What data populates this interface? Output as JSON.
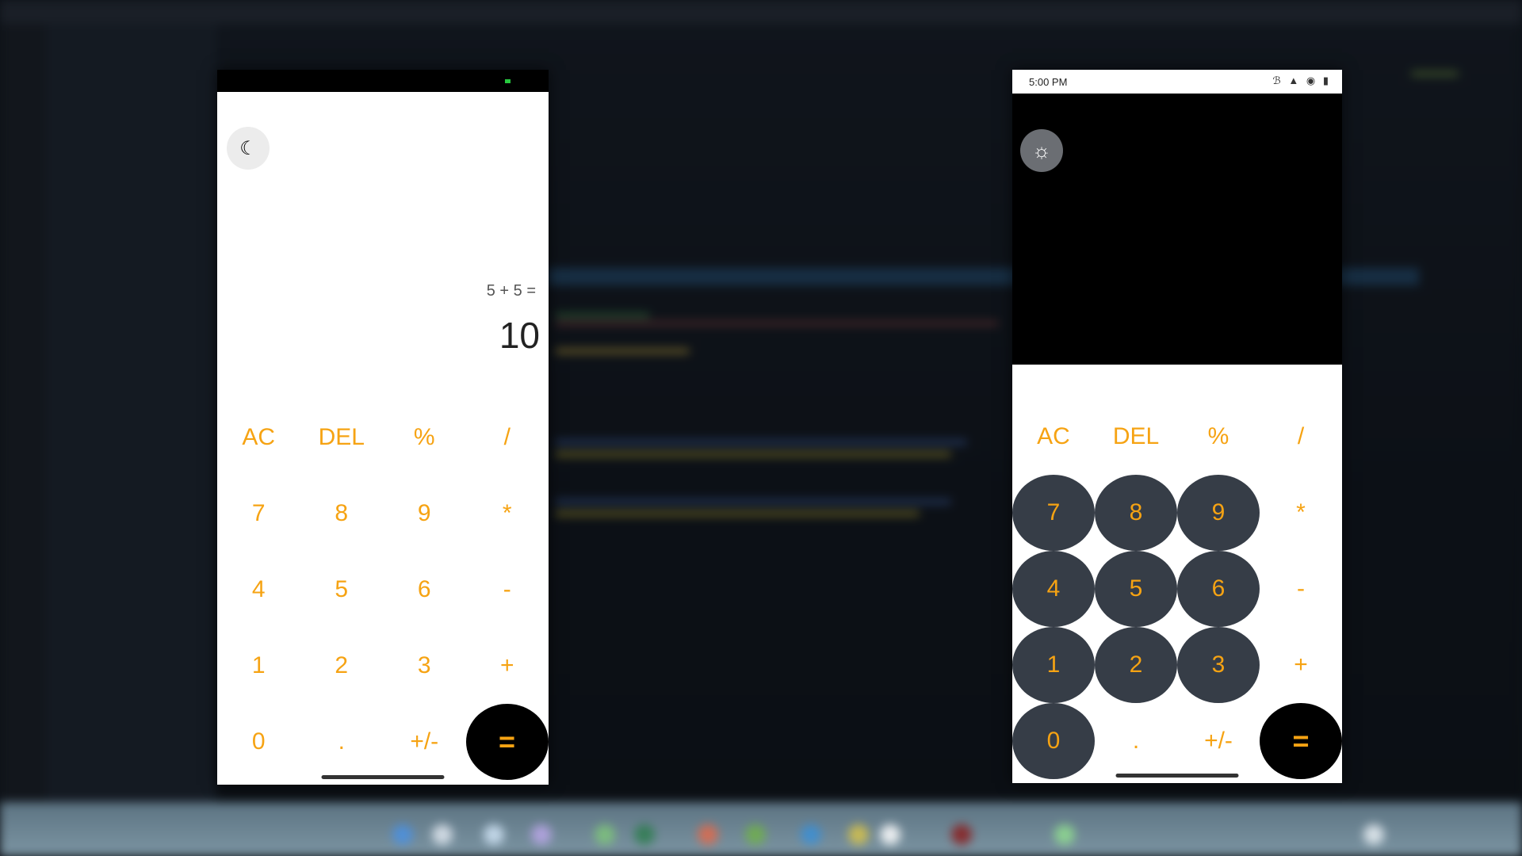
{
  "left_phone": {
    "theme_toggle_icon": "moon-icon",
    "display": {
      "expression": "5 + 5 =",
      "result": "10"
    },
    "keys": [
      {
        "label": "AC",
        "kind": "plain"
      },
      {
        "label": "DEL",
        "kind": "plain"
      },
      {
        "label": "%",
        "kind": "plain"
      },
      {
        "label": "/",
        "kind": "plain"
      },
      {
        "label": "7",
        "kind": "plain"
      },
      {
        "label": "8",
        "kind": "plain"
      },
      {
        "label": "9",
        "kind": "plain"
      },
      {
        "label": "*",
        "kind": "plain"
      },
      {
        "label": "4",
        "kind": "plain"
      },
      {
        "label": "5",
        "kind": "plain"
      },
      {
        "label": "6",
        "kind": "plain"
      },
      {
        "label": "-",
        "kind": "plain"
      },
      {
        "label": "1",
        "kind": "plain"
      },
      {
        "label": "2",
        "kind": "plain"
      },
      {
        "label": "3",
        "kind": "plain"
      },
      {
        "label": "+",
        "kind": "plain"
      },
      {
        "label": "0",
        "kind": "plain"
      },
      {
        "label": ".",
        "kind": "plain"
      },
      {
        "label": "+/-",
        "kind": "plain"
      },
      {
        "label": "=",
        "kind": "equals"
      }
    ]
  },
  "right_phone": {
    "status_time": "5:00 PM",
    "theme_toggle_icon": "sun-icon",
    "keys": [
      {
        "label": "AC",
        "kind": "plain"
      },
      {
        "label": "DEL",
        "kind": "plain"
      },
      {
        "label": "%",
        "kind": "plain"
      },
      {
        "label": "/",
        "kind": "plain"
      },
      {
        "label": "7",
        "kind": "dark"
      },
      {
        "label": "8",
        "kind": "dark"
      },
      {
        "label": "9",
        "kind": "dark"
      },
      {
        "label": "*",
        "kind": "plain"
      },
      {
        "label": "4",
        "kind": "dark"
      },
      {
        "label": "5",
        "kind": "dark"
      },
      {
        "label": "6",
        "kind": "dark"
      },
      {
        "label": "-",
        "kind": "plain"
      },
      {
        "label": "1",
        "kind": "dark"
      },
      {
        "label": "2",
        "kind": "dark"
      },
      {
        "label": "3",
        "kind": "dark"
      },
      {
        "label": "+",
        "kind": "plain"
      },
      {
        "label": "0",
        "kind": "dark"
      },
      {
        "label": ".",
        "kind": "plain"
      },
      {
        "label": "+/-",
        "kind": "plain"
      },
      {
        "label": "=",
        "kind": "equals"
      }
    ]
  },
  "colors": {
    "accent": "#f6a313",
    "dark_key": "#363d47",
    "equals_key": "#000000"
  }
}
